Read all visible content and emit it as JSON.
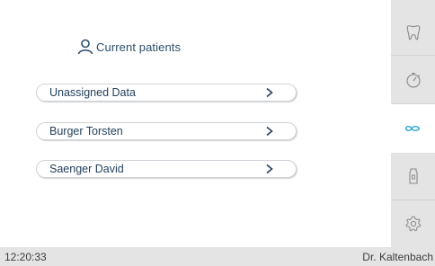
{
  "header": {
    "title": "Current patients",
    "icon": "person-icon"
  },
  "patients": [
    {
      "label": "Unassigned Data"
    },
    {
      "label": "Burger Torsten"
    },
    {
      "label": "Saenger David"
    }
  ],
  "sidebar": {
    "items": [
      {
        "icon": "tooth-icon",
        "active": false
      },
      {
        "icon": "stopwatch-icon",
        "active": false
      },
      {
        "icon": "link-icon",
        "active": true
      },
      {
        "icon": "bottle-icon",
        "active": false
      },
      {
        "icon": "gear-icon",
        "active": false
      }
    ]
  },
  "status": {
    "time": "12:20:33",
    "user": "Dr. Kaltenbach"
  },
  "colors": {
    "accent": "#1c9fcf",
    "text": "#24405c",
    "sidebar_bg": "#e4e4e4"
  }
}
